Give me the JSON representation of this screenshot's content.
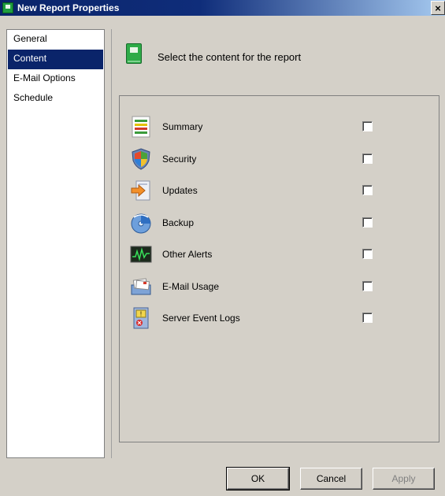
{
  "window": {
    "title": "New Report Properties",
    "close_glyph": "×"
  },
  "nav": {
    "items": [
      {
        "label": "General",
        "active": false
      },
      {
        "label": "Content",
        "active": true
      },
      {
        "label": "E-Mail Options",
        "active": false
      },
      {
        "label": "Schedule",
        "active": false
      }
    ]
  },
  "content": {
    "header_icon": "report-book-icon",
    "header_text": "Select the content for the report",
    "items": [
      {
        "label": "Summary",
        "icon": "summary-icon",
        "checked": false
      },
      {
        "label": "Security",
        "icon": "security-shield-icon",
        "checked": false
      },
      {
        "label": "Updates",
        "icon": "updates-icon",
        "checked": false
      },
      {
        "label": "Backup",
        "icon": "backup-icon",
        "checked": false
      },
      {
        "label": "Other Alerts",
        "icon": "alerts-monitor-icon",
        "checked": false
      },
      {
        "label": "E-Mail Usage",
        "icon": "email-usage-icon",
        "checked": false
      },
      {
        "label": "Server Event Logs",
        "icon": "event-log-icon",
        "checked": false
      }
    ]
  },
  "buttons": {
    "ok": "OK",
    "cancel": "Cancel",
    "apply": "Apply"
  }
}
